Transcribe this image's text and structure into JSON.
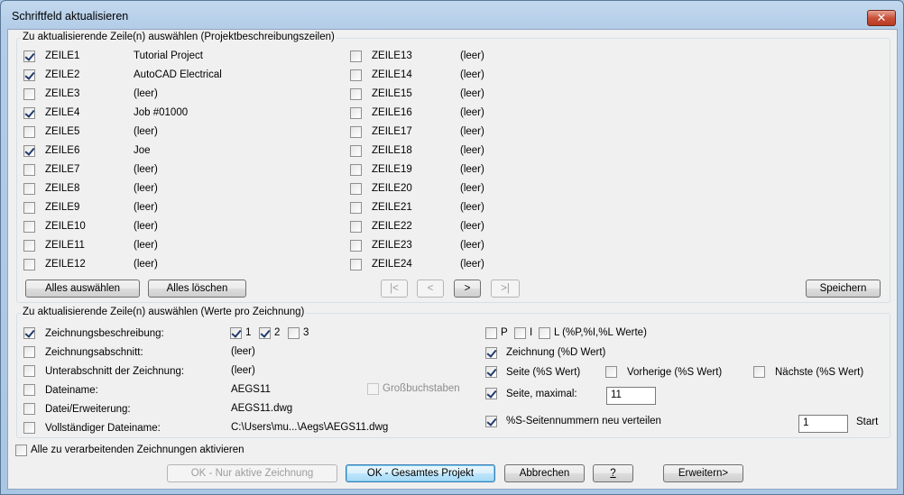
{
  "window": {
    "title": "Schriftfeld aktualisieren",
    "close_label": "✕"
  },
  "group1": {
    "label": "Zu aktualisierende Zeile(n) auswählen (Projektbeschreibungszeilen)",
    "rows": [
      {
        "name": "ZEILE1",
        "value": "Tutorial Project",
        "checked": true
      },
      {
        "name": "ZEILE2",
        "value": "AutoCAD Electrical",
        "checked": true
      },
      {
        "name": "ZEILE3",
        "value": "(leer)",
        "checked": false
      },
      {
        "name": "ZEILE4",
        "value": "Job #01000",
        "checked": true
      },
      {
        "name": "ZEILE5",
        "value": "(leer)",
        "checked": false
      },
      {
        "name": "ZEILE6",
        "value": "Joe",
        "checked": true
      },
      {
        "name": "ZEILE7",
        "value": "(leer)",
        "checked": false
      },
      {
        "name": "ZEILE8",
        "value": "(leer)",
        "checked": false
      },
      {
        "name": "ZEILE9",
        "value": "(leer)",
        "checked": false
      },
      {
        "name": "ZEILE10",
        "value": "(leer)",
        "checked": false
      },
      {
        "name": "ZEILE11",
        "value": "(leer)",
        "checked": false
      },
      {
        "name": "ZEILE12",
        "value": "(leer)",
        "checked": false
      },
      {
        "name": "ZEILE13",
        "value": "(leer)",
        "checked": false
      },
      {
        "name": "ZEILE14",
        "value": "(leer)",
        "checked": false
      },
      {
        "name": "ZEILE15",
        "value": "(leer)",
        "checked": false
      },
      {
        "name": "ZEILE16",
        "value": "(leer)",
        "checked": false
      },
      {
        "name": "ZEILE17",
        "value": "(leer)",
        "checked": false
      },
      {
        "name": "ZEILE18",
        "value": "(leer)",
        "checked": false
      },
      {
        "name": "ZEILE19",
        "value": "(leer)",
        "checked": false
      },
      {
        "name": "ZEILE20",
        "value": "(leer)",
        "checked": false
      },
      {
        "name": "ZEILE21",
        "value": "(leer)",
        "checked": false
      },
      {
        "name": "ZEILE22",
        "value": "(leer)",
        "checked": false
      },
      {
        "name": "ZEILE23",
        "value": "(leer)",
        "checked": false
      },
      {
        "name": "ZEILE24",
        "value": "(leer)",
        "checked": false
      }
    ],
    "select_all": "Alles auswählen",
    "clear_all": "Alles löschen",
    "nav_first": "|<",
    "nav_prev": "<",
    "nav_next": ">",
    "nav_last": ">|",
    "save": "Speichern"
  },
  "group2": {
    "label": "Zu aktualisierende Zeile(n) auswählen (Werte pro Zeichnung)",
    "rows": [
      {
        "label": "Zeichnungsbeschreibung:",
        "checked": true,
        "value": ""
      },
      {
        "label": "Zeichnungsabschnitt:",
        "checked": false,
        "value": "(leer)"
      },
      {
        "label": "Unterabschnitt der Zeichnung:",
        "checked": false,
        "value": "(leer)"
      },
      {
        "label": "Dateiname:",
        "checked": false,
        "value": "AEGS11"
      },
      {
        "label": "Datei/Erweiterung:",
        "checked": false,
        "value": "AEGS11.dwg"
      },
      {
        "label": "Vollständiger Dateiname:",
        "checked": false,
        "value": "C:\\Users\\mu...\\Aegs\\AEGS11.dwg"
      }
    ],
    "desc_lines": [
      {
        "label": "1",
        "checked": true
      },
      {
        "label": "2",
        "checked": true
      },
      {
        "label": "3",
        "checked": false
      }
    ],
    "uppercase": "Großbuchstaben",
    "p_label": "P",
    "i_label": "I",
    "l_label": "L (%P,%I,%L Werte)",
    "zeichnung_label": "Zeichnung (%D Wert)",
    "seite_label": "Seite (%S Wert)",
    "vorherige_label": "Vorherige (%S Wert)",
    "naechste_label": "Nächste (%S Wert)",
    "seite_max_label": "Seite, maximal:",
    "seite_max_value": "11",
    "renumber_label": "%S-Seitennummern neu verteilen",
    "start_value": "1",
    "start_label": "Start"
  },
  "footer": {
    "activate_all": "Alle zu verarbeitenden Zeichnungen aktivieren",
    "ok_active": "OK - Nur aktive Zeichnung",
    "ok_project": "OK - Gesamtes Projekt",
    "cancel": "Abbrechen",
    "help": "?",
    "expand": "Erweitern>"
  }
}
